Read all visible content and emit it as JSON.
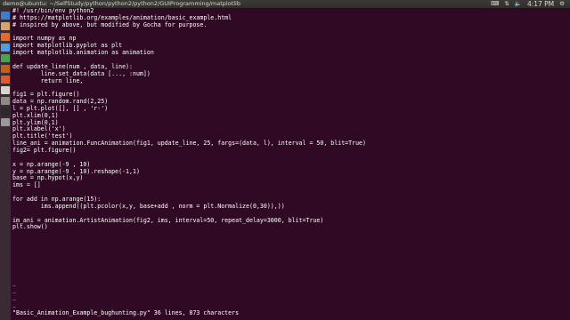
{
  "topbar": {
    "title": "demo@ubuntu: ~/SelfStudy/python/python2/python2/GUIProgramming/matplotlib",
    "time": "4:17 PM"
  },
  "launcher": {
    "items": [
      {
        "name": "dash-icon",
        "color": "#3d7dcf"
      },
      {
        "name": "files-icon",
        "color": "#d7a46a"
      },
      {
        "name": "firefox-icon",
        "color": "#e66b2a"
      },
      {
        "name": "writer-icon",
        "color": "#4f9fe0"
      },
      {
        "name": "calc-icon",
        "color": "#46a64b"
      },
      {
        "name": "impress-icon",
        "color": "#c45e1c"
      },
      {
        "name": "software-center-icon",
        "color": "#e05a2b"
      },
      {
        "name": "amazon-icon",
        "color": "#d9d5cc"
      },
      {
        "name": "settings-icon",
        "color": "#8e8b85"
      },
      {
        "name": "terminal-icon",
        "color": "#2a2a2a"
      },
      {
        "name": "trash-icon",
        "color": "#9a9a9a"
      }
    ]
  },
  "code_lines": [
    "#! /usr/bin/env python2",
    "# https://matplotlib.org/examples/animation/basic_example.html",
    "# inspired by above, but modified by Gocha for purpose.",
    "",
    "import numpy as np",
    "import matplotlib.pyplot as plt",
    "import matplotlib.animation as animation",
    "",
    "def update_line(num , data, line):",
    "        line.set_data(data [..., :num])",
    "        return line,",
    "",
    "fig1 = plt.figure()",
    "data = np.random.rand(2,25)",
    "l = plt.plot([], [] , 'r-')",
    "plt.xlim(0,1)",
    "plt.ylim(0,1)",
    "plt.xlabel('x')",
    "plt.title('test')",
    "line_ani = animation.FuncAnimation(fig1, update_line, 25, fargs=(data, l), interval = 50, blit=True)",
    "fig2= plt.figure()",
    "",
    "x = np.arange(-9 , 10)",
    "y = np.arange(-9 , 10).reshape(-1,1)",
    "base = np.hypot(x,y)",
    "ims = []",
    "",
    "for add in np.arange(15):",
    "        ims.append((plt.pcolor(x,y, base+add , norm = plt.Normalize(0,30)),))",
    "",
    "im_ani = animation.ArtistAnimation(fig2, ims, interval=50, repeat_delay=3000, blit=True)",
    "plt.show()"
  ],
  "tilde_lines": [
    "~",
    "~",
    "~",
    "~"
  ],
  "status_line": "\"Basic_Animation_Example_bughunting.py\" 36 lines, 873 characters"
}
